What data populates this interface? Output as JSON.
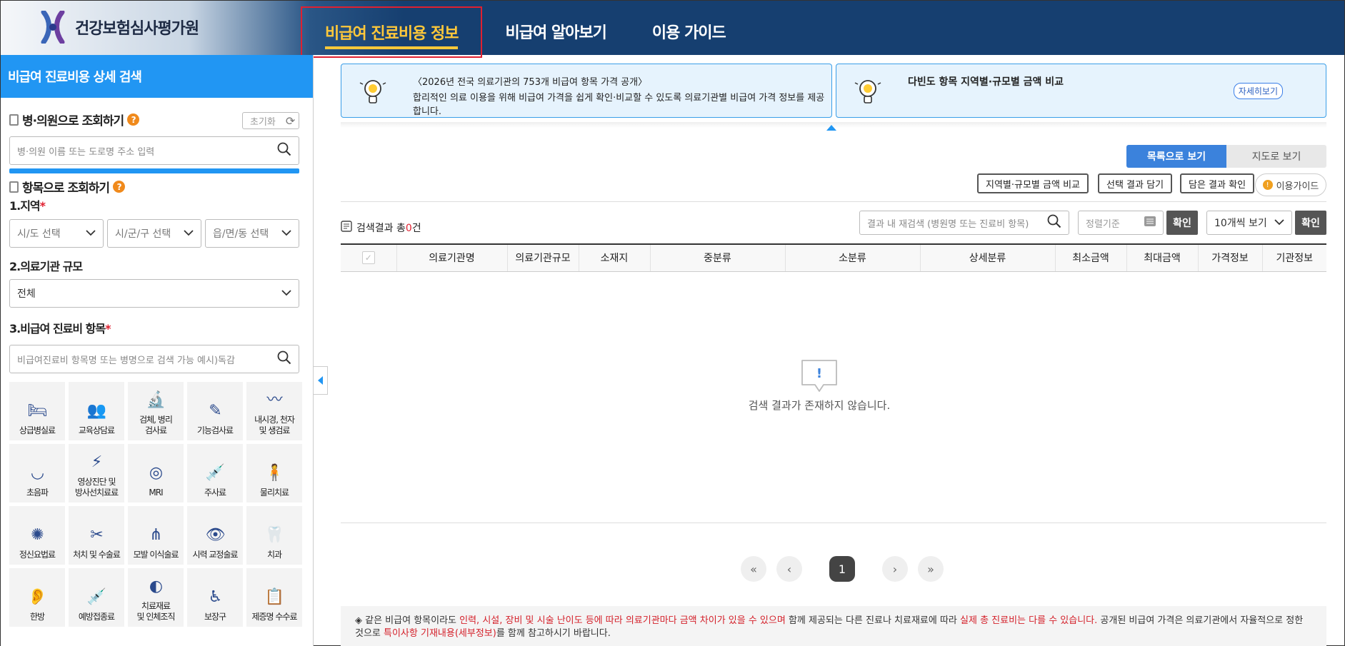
{
  "header": {
    "logo_text": "건강보험심사평가원",
    "nav": [
      "비급여 진료비용 정보",
      "비급여 알아보기",
      "이용 가이드"
    ]
  },
  "sidebar": {
    "title": "비급여 진료비용 상세 검색",
    "hospital_search": {
      "title": "병·의원으로 조회하기",
      "reset_label": "초기화",
      "placeholder": "병·의원 이름 또는 도로명 주소 입력"
    },
    "item_search": {
      "title": "항목으로 조회하기",
      "region_label": "1.지역",
      "region_selects": [
        "시/도 선택",
        "시/군/구 선택",
        "읍/면/동 선택"
      ],
      "scale_label": "2.의료기관 규모",
      "scale_value": "전체",
      "items_label": "3.비급여 진료비 항목",
      "items_placeholder": "비급여진료비 항목명 또는 병명으로 검색 가능 예시)독감"
    },
    "categories": [
      {
        "line1": "상급병실료",
        "line2": "",
        "icon": "bed-icon"
      },
      {
        "line1": "교육상담료",
        "line2": "",
        "icon": "counseling-icon"
      },
      {
        "line1": "검체, 병리",
        "line2": "검사료",
        "icon": "specimen-icon"
      },
      {
        "line1": "기능검사료",
        "line2": "",
        "icon": "function-test-icon"
      },
      {
        "line1": "내시경, 천자",
        "line2": "및 생검료",
        "icon": "endoscope-icon"
      },
      {
        "line1": "초음파",
        "line2": "",
        "icon": "ultrasound-icon"
      },
      {
        "line1": "영상진단 및",
        "line2": "방사선치료료",
        "icon": "radiology-icon"
      },
      {
        "line1": "MRI",
        "line2": "",
        "icon": "mri-icon"
      },
      {
        "line1": "주사료",
        "line2": "",
        "icon": "syringe-icon"
      },
      {
        "line1": "물리치료",
        "line2": "",
        "icon": "physical-therapy-icon"
      },
      {
        "line1": "정신요법료",
        "line2": "",
        "icon": "brain-icon"
      },
      {
        "line1": "처치 및 수술료",
        "line2": "",
        "icon": "surgery-icon"
      },
      {
        "line1": "모발 이식술료",
        "line2": "",
        "icon": "hair-transplant-icon"
      },
      {
        "line1": "시력 교정술료",
        "line2": "",
        "icon": "eye-icon"
      },
      {
        "line1": "치과",
        "line2": "",
        "icon": "tooth-icon"
      },
      {
        "line1": "한방",
        "line2": "",
        "icon": "acupuncture-icon"
      },
      {
        "line1": "예방접종료",
        "line2": "",
        "icon": "vaccine-icon"
      },
      {
        "line1": "치료재료",
        "line2": "및 인체조직",
        "icon": "implant-icon"
      },
      {
        "line1": "보장구",
        "line2": "",
        "icon": "wheelchair-icon"
      },
      {
        "line1": "제증명 수수료",
        "line2": "",
        "icon": "certificate-icon"
      }
    ]
  },
  "banners": {
    "left_title": "〈2026년 전국 의료기관의 753개 비급여 항목 가격 공개〉",
    "left_text": "합리적인 의료 이용을 위해 비급여 가격을 쉽게 확인·비교할 수 있도록 의료기관별 비급여 가격 정보를 제공합니다.",
    "right_title": "다빈도 항목 지역별·규모별 금액 비교",
    "right_button": "자세히보기"
  },
  "view_toggle": [
    "목록으로 보기",
    "지도로 보기"
  ],
  "actions": [
    "지역별·규모별 금액 비교",
    "선택 결과 담기",
    "담은 결과 확인"
  ],
  "guide_button": "이용가이드",
  "results": {
    "count_prefix": "검색결과 총",
    "count": "0",
    "count_suffix": "건",
    "re_search_placeholder": "결과 내 재검색 (병원명 또는 진료비 항목)",
    "sort_placeholder": "정렬기준",
    "confirm": "확인",
    "per_page": "10개씩 보기",
    "columns": [
      "의료기관명",
      "의료기관규모",
      "소재지",
      "중분류",
      "소분류",
      "상세분류",
      "최소금액",
      "최대금액",
      "가격정보",
      "기관정보"
    ],
    "empty_text": "검색 결과가 존재하지 않습니다."
  },
  "pagination": {
    "current": "1"
  },
  "notice": {
    "p1": "◈ 같은 비급여 항목이라도 ",
    "r1": "인력, 시설, 장비 및 시술 난이도 등에 따라 의료기관마다 금액 차이가 있을 수 있으며",
    "p2": " 함께 제공되는 다른 진료나 치료재료에 따라 ",
    "r2": "실제 총 진료비는 다를 수 있습니다.",
    "p3": " 공개된 비급여 가격은 의료기관에서 자율적으로 정한 것으로 ",
    "r3": "특이사항 기재내용(세부정보)",
    "p4": "를 함께 참고하시기 바랍니다."
  }
}
